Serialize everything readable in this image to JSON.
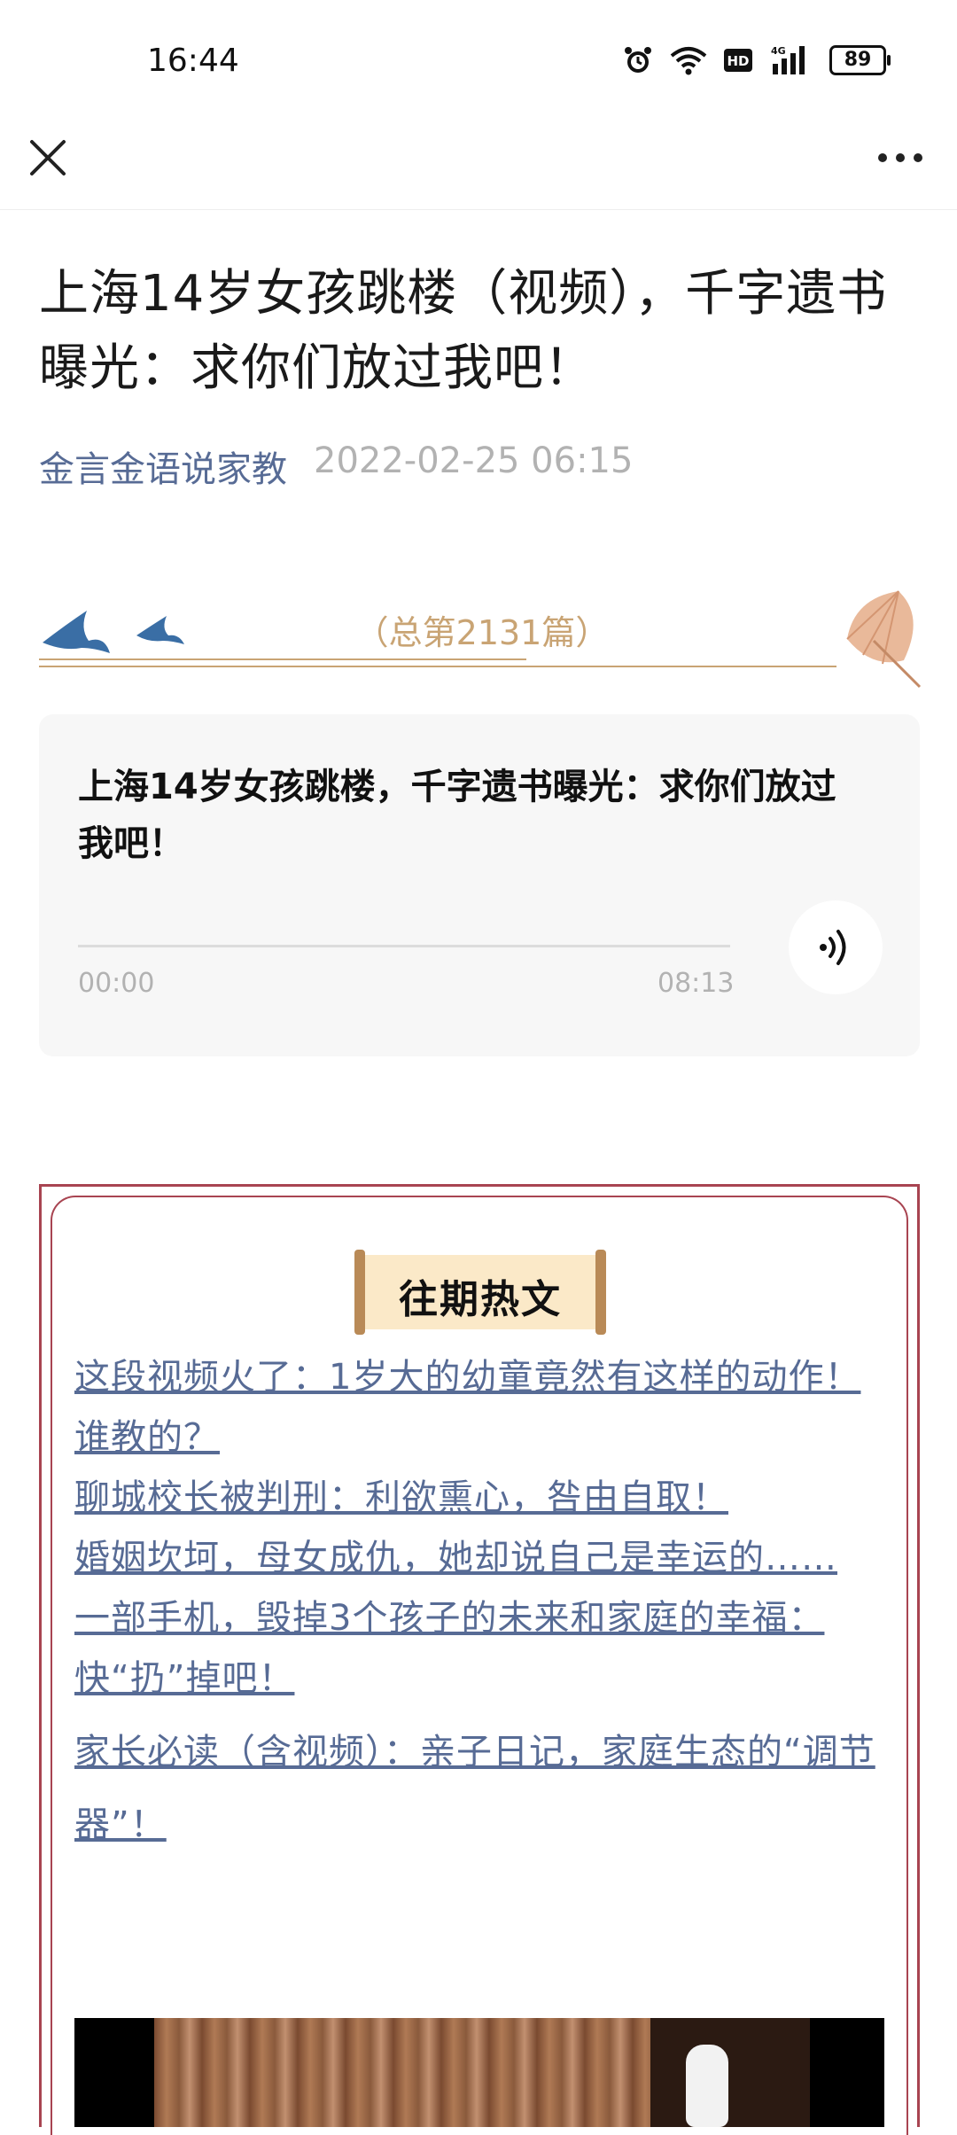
{
  "status_bar": {
    "time": "16:44",
    "battery": "89",
    "network": "4G"
  },
  "article": {
    "title": "上海14岁女孩跳楼（视频），千字遗书曝光：求你们放过我吧！",
    "author": "金言金语说家教",
    "date": "2022-02-25 06:15",
    "issue_label": "（总第2131篇）"
  },
  "audio": {
    "title": "上海14岁女孩跳楼，千字遗书曝光：求你们放过我吧！",
    "current_time": "00:00",
    "duration": "08:13",
    "progress": 0
  },
  "hot_articles": {
    "heading": "往期热文",
    "links": [
      "这段视频火了：1岁大的幼童竟然有这样的动作！谁教的？",
      "聊城校长被判刑：利欲熏心，咎由自取！",
      "婚姻坎坷，母女成仇，她却说自己是幸运的……",
      "一部手机，毁掉3个孩子的未来和家庭的幸福：快“扔”掉吧！",
      "家长必读（含视频）：亲子日记，家庭生态的“调节器”！"
    ]
  },
  "colors": {
    "link": "#576b95",
    "frame": "#a84451",
    "ornament": "#c9a474",
    "scroll": "#fbe9c8"
  }
}
